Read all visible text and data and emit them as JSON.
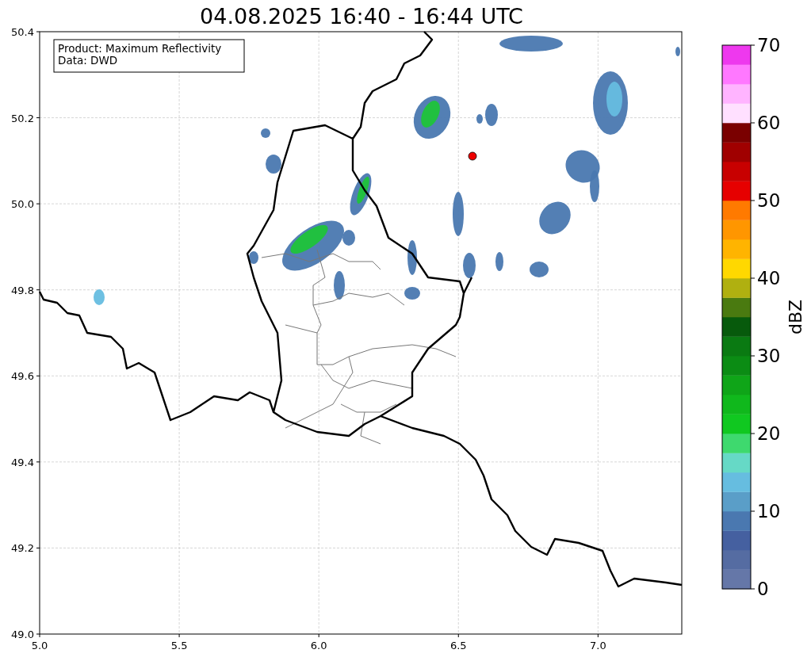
{
  "title": "04.08.2025 16:40 - 16:44 UTC",
  "info_box": {
    "lines": [
      "Product: Maximum Reflectivity",
      "Data: DWD"
    ]
  },
  "map": {
    "xticks": [
      "5.0",
      "5.5",
      "6.0",
      "6.5",
      "7.0"
    ],
    "yticks": [
      "50.4",
      "50.2",
      "50.0",
      "49.8",
      "49.6",
      "49.4",
      "49.2",
      "49.0"
    ]
  },
  "colorbar": {
    "label": "dBZ",
    "ticks": [
      "70",
      "60",
      "50",
      "40",
      "30",
      "20",
      "10",
      "0"
    ],
    "steps": [
      {
        "color": "#6577a8"
      },
      {
        "color": "#556ca2"
      },
      {
        "color": "#4560a0"
      },
      {
        "color": "#4a78b0"
      },
      {
        "color": "#5a9ec8"
      },
      {
        "color": "#66bde0"
      },
      {
        "color": "#66d9c6"
      },
      {
        "color": "#3ed96e"
      },
      {
        "color": "#10c820"
      },
      {
        "color": "#10b81c"
      },
      {
        "color": "#0fa518"
      },
      {
        "color": "#0b8c14"
      },
      {
        "color": "#0a7a12"
      },
      {
        "color": "#075a0c"
      },
      {
        "color": "#4a7a10"
      },
      {
        "color": "#b0b010"
      },
      {
        "color": "#ffd800"
      },
      {
        "color": "#ffb400"
      },
      {
        "color": "#ff9600"
      },
      {
        "color": "#ff7a00"
      },
      {
        "color": "#e60000"
      },
      {
        "color": "#c80000"
      },
      {
        "color": "#a00000"
      },
      {
        "color": "#7a0000"
      },
      {
        "color": "#ffe0ff"
      },
      {
        "color": "#ffb4ff"
      },
      {
        "color": "#ff78ff"
      },
      {
        "color": "#ee38ee"
      }
    ]
  }
}
